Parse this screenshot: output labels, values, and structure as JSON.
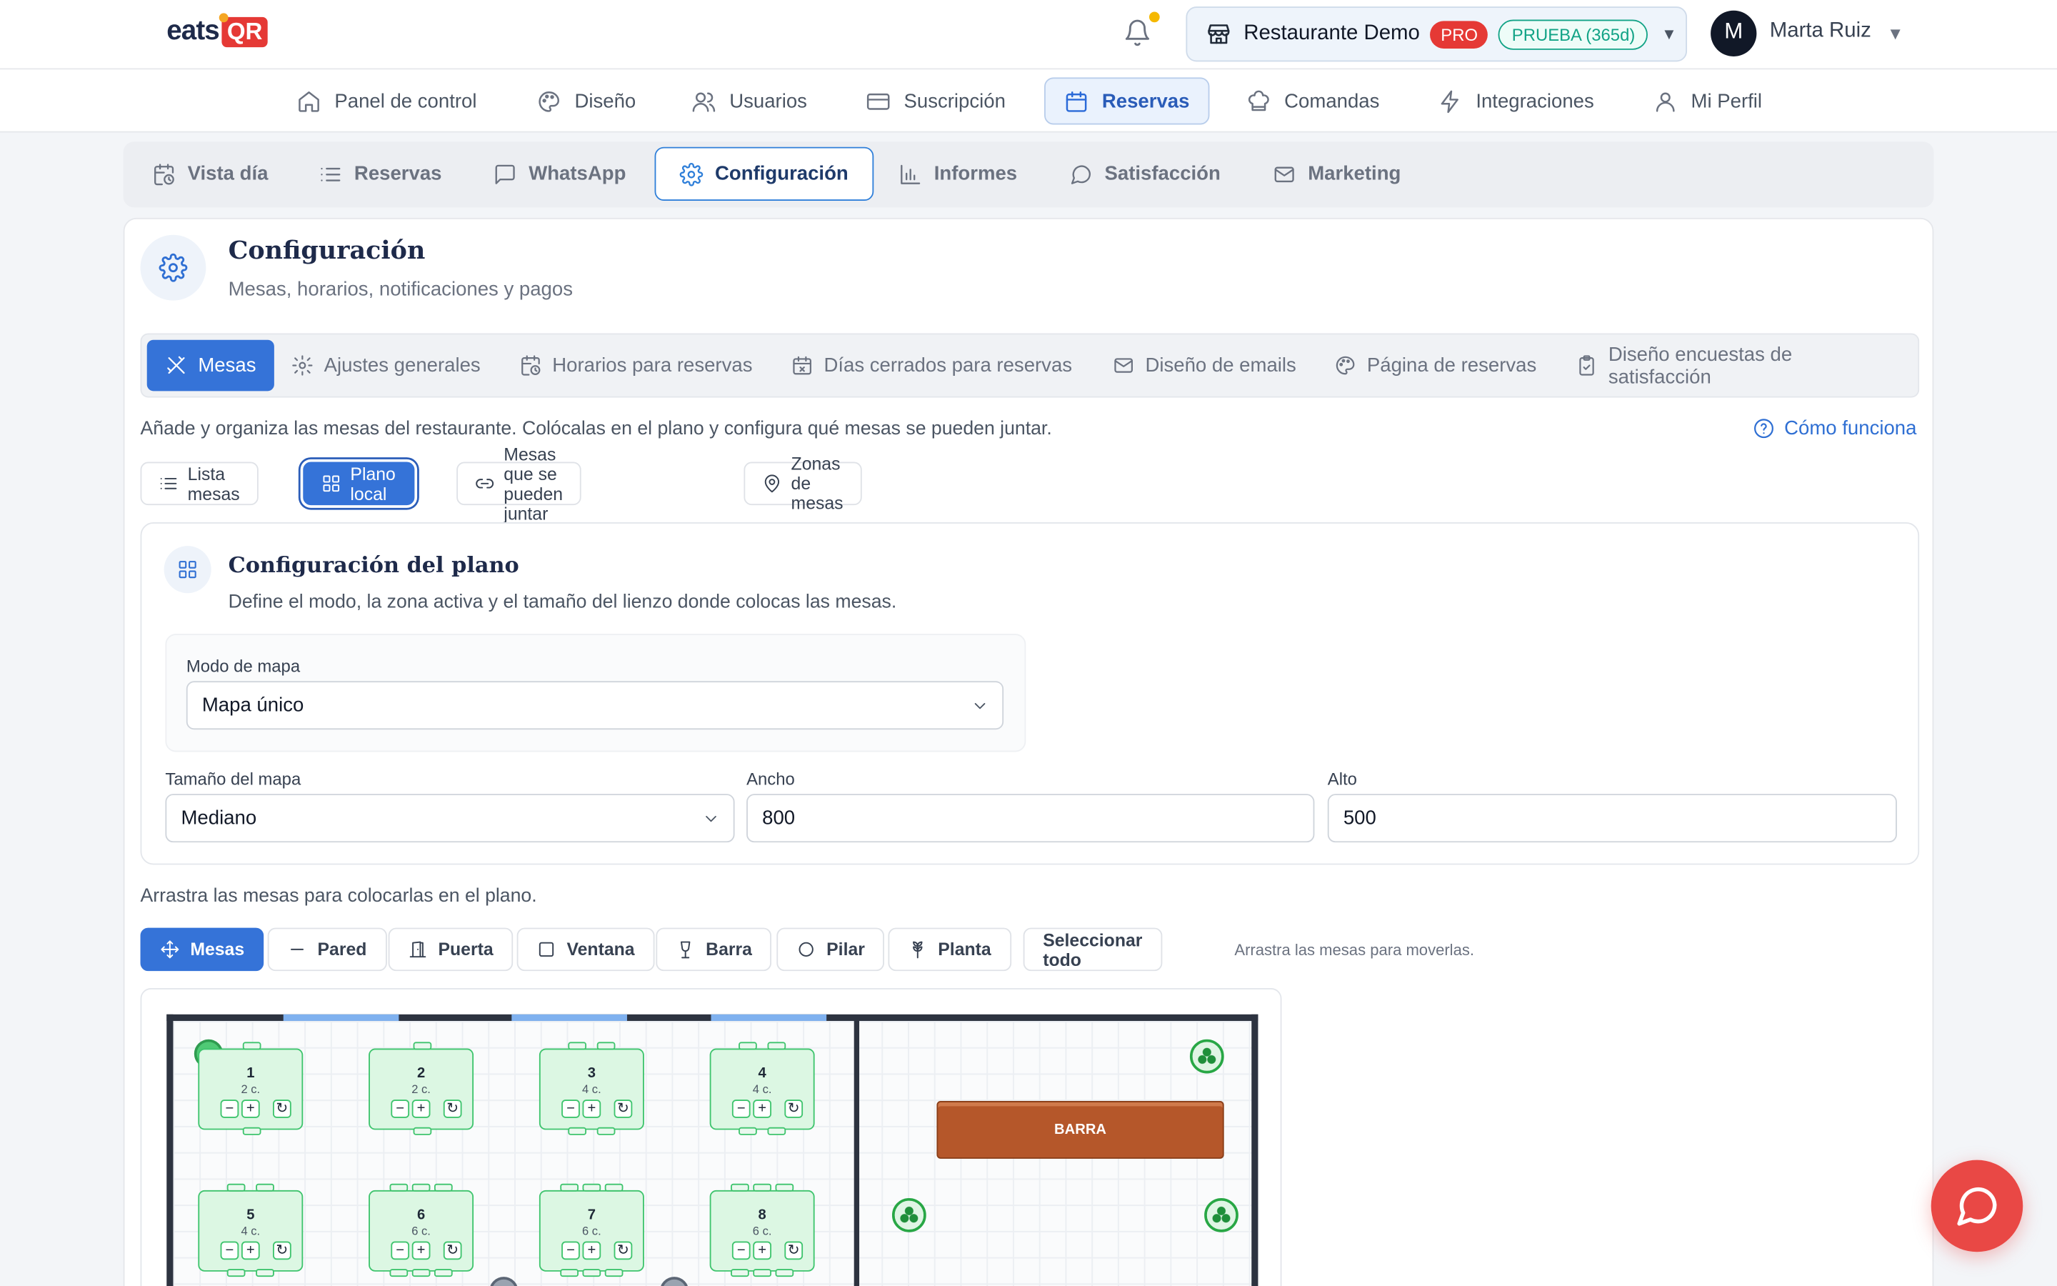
{
  "brand": {
    "logo_left": "eats",
    "logo_right": "QR"
  },
  "header": {
    "restaurant": "Restaurante Demo",
    "plan_badge": "PRO",
    "trial_badge": "PRUEBA (365d)",
    "user_initial": "M",
    "user_name": "Marta Ruiz"
  },
  "main_nav": [
    {
      "label": "Panel de control",
      "icon": "home-icon"
    },
    {
      "label": "Diseño",
      "icon": "palette-icon"
    },
    {
      "label": "Usuarios",
      "icon": "users-icon"
    },
    {
      "label": "Suscripción",
      "icon": "credit-card-icon"
    },
    {
      "label": "Reservas",
      "icon": "calendar-icon",
      "active": true
    },
    {
      "label": "Comandas",
      "icon": "chef-hat-icon"
    },
    {
      "label": "Integraciones",
      "icon": "bolt-icon"
    },
    {
      "label": "Mi Perfil",
      "icon": "user-icon"
    }
  ],
  "sub_tabs": [
    {
      "label": "Vista día",
      "icon": "calendar-clock-icon"
    },
    {
      "label": "Reservas",
      "icon": "list-icon"
    },
    {
      "label": "WhatsApp",
      "icon": "message-square-icon"
    },
    {
      "label": "Configuración",
      "icon": "gear-icon",
      "active": true
    },
    {
      "label": "Informes",
      "icon": "bar-chart-icon"
    },
    {
      "label": "Satisfacción",
      "icon": "message-circle-icon"
    },
    {
      "label": "Marketing",
      "icon": "mail-icon"
    }
  ],
  "page": {
    "title": "Configuración",
    "subtitle": "Mesas, horarios, notificaciones y pagos"
  },
  "config_tabs": [
    {
      "label": "Mesas",
      "icon": "utensils-icon",
      "active": true
    },
    {
      "label": "Ajustes generales",
      "icon": "gear-icon"
    },
    {
      "label": "Horarios para reservas",
      "icon": "calendar-clock-icon"
    },
    {
      "label": "Días cerrados para reservas",
      "icon": "calendar-x-icon"
    },
    {
      "label": "Diseño de emails",
      "icon": "mail-icon"
    },
    {
      "label": "Página de reservas",
      "icon": "palette-icon"
    },
    {
      "label": "Diseño encuestas de satisfacción",
      "icon": "clipboard-icon"
    }
  ],
  "intro": "Añade y organiza las mesas del restaurante. Colócalas en el plano y configura qué mesas se pueden juntar.",
  "how_link": "Cómo funciona",
  "view_tabs": [
    {
      "label": "Lista mesas",
      "icon": "list-icon"
    },
    {
      "label": "Plano local",
      "icon": "grid-icon",
      "active": true
    },
    {
      "label": "Mesas que se pueden juntar",
      "icon": "link-icon"
    },
    {
      "label": "Zonas de mesas",
      "icon": "map-pin-icon"
    }
  ],
  "plan_config": {
    "title": "Configuración del plano",
    "subtitle": "Define el modo, la zona activa y el tamaño del lienzo donde colocas las mesas.",
    "map_mode_label": "Modo de mapa",
    "map_mode_value": "Mapa único",
    "map_size_label": "Tamaño del mapa",
    "map_size_value": "Mediano",
    "width_label": "Ancho",
    "width_value": "800",
    "height_label": "Alto",
    "height_value": "500"
  },
  "drag_hint": "Arrastra las mesas para colocarlas en el plano.",
  "tools": [
    {
      "label": "Mesas",
      "icon": "move-icon",
      "active": true
    },
    {
      "label": "Pared",
      "icon": "minus-icon"
    },
    {
      "label": "Puerta",
      "icon": "door-icon"
    },
    {
      "label": "Ventana",
      "icon": "square-icon"
    },
    {
      "label": "Barra",
      "icon": "wine-glass-icon"
    },
    {
      "label": "Pilar",
      "icon": "circle-icon"
    },
    {
      "label": "Planta",
      "icon": "plant-icon"
    },
    {
      "label": "Seleccionar todo",
      "icon": ""
    }
  ],
  "tools_hint": "Arrastra las mesas para moverlas.",
  "tables": [
    {
      "number": "1",
      "capacity": "2 c."
    },
    {
      "number": "2",
      "capacity": "2 c."
    },
    {
      "number": "3",
      "capacity": "4 c."
    },
    {
      "number": "4",
      "capacity": "4 c."
    },
    {
      "number": "5",
      "capacity": "4 c."
    },
    {
      "number": "6",
      "capacity": "6 c."
    },
    {
      "number": "7",
      "capacity": "6 c."
    },
    {
      "number": "8",
      "capacity": "6 c."
    }
  ],
  "bar_label": "BARRA",
  "colors": {
    "primary": "#3573d8",
    "accent_red": "#e53935",
    "table_green": "#3ec46d",
    "bar_brown": "#b5572a"
  }
}
